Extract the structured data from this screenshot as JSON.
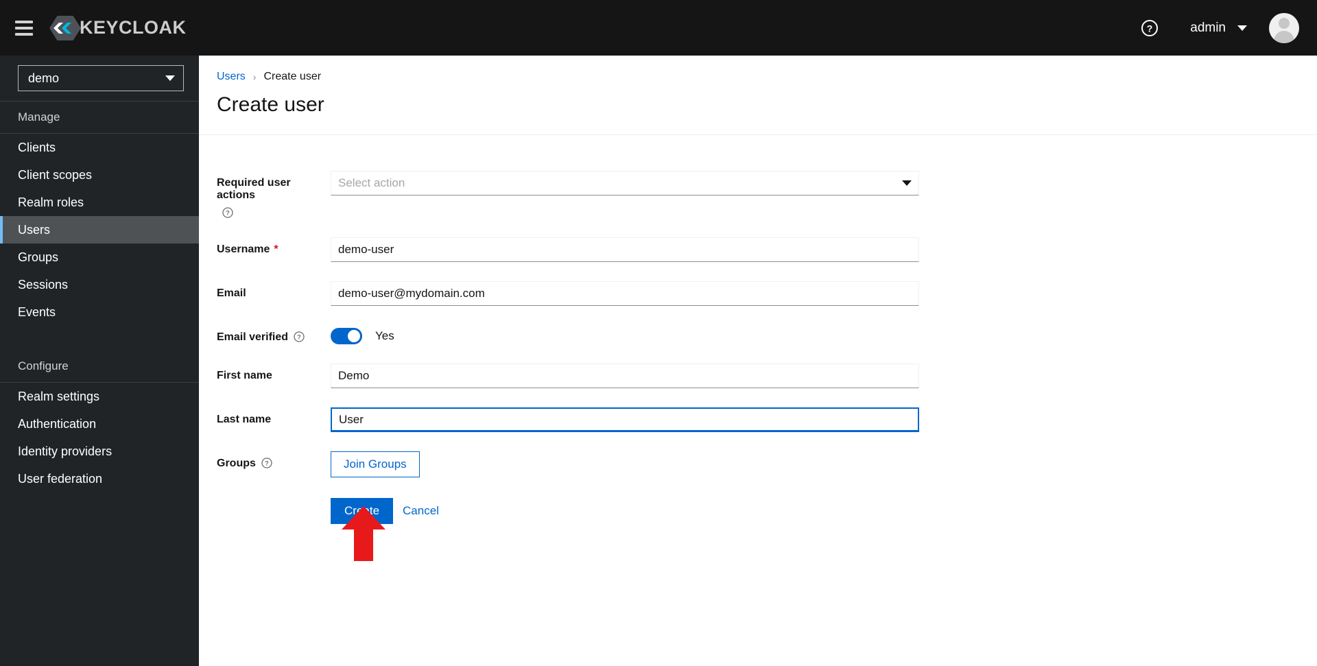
{
  "masthead": {
    "menu_icon": "hamburger-icon",
    "brand_name": "KEYCLOAK",
    "help_icon": "help-circle-icon",
    "user_name": "admin",
    "user_caret_icon": "chevron-down-icon",
    "avatar_icon": "user-avatar-icon",
    "background_color": "#151515"
  },
  "sidebar": {
    "realm_selector": {
      "value": "demo",
      "caret_icon": "chevron-down-icon"
    },
    "groups": [
      {
        "title": "Manage",
        "items": [
          {
            "label": "Clients",
            "active": false
          },
          {
            "label": "Client scopes",
            "active": false
          },
          {
            "label": "Realm roles",
            "active": false
          },
          {
            "label": "Users",
            "active": true
          },
          {
            "label": "Groups",
            "active": false
          },
          {
            "label": "Sessions",
            "active": false
          },
          {
            "label": "Events",
            "active": false
          }
        ]
      },
      {
        "title": "Configure",
        "items": [
          {
            "label": "Realm settings",
            "active": false
          },
          {
            "label": "Authentication",
            "active": false
          },
          {
            "label": "Identity providers",
            "active": false
          },
          {
            "label": "User federation",
            "active": false
          }
        ]
      }
    ],
    "background_color": "#212427",
    "active_indicator_color": "#73bcf7"
  },
  "page": {
    "breadcrumb": {
      "parent": "Users",
      "separator": "›",
      "current": "Create user"
    },
    "title": "Create user"
  },
  "form": {
    "required_user_actions": {
      "label": "Required user actions",
      "help_icon": "help-circle-icon",
      "placeholder": "Select action",
      "value": "",
      "caret_icon": "chevron-down-icon"
    },
    "username": {
      "label": "Username",
      "required_marker": "*",
      "value": "demo-user"
    },
    "email": {
      "label": "Email",
      "value": "demo-user@mydomain.com"
    },
    "email_verified": {
      "label": "Email verified",
      "help_icon": "help-circle-icon",
      "toggle_state": "on",
      "state_label": "Yes"
    },
    "first_name": {
      "label": "First name",
      "value": "Demo"
    },
    "last_name": {
      "label": "Last name",
      "value": "User",
      "focused": true
    },
    "groups": {
      "label": "Groups",
      "help_icon": "help-circle-icon",
      "button_label": "Join Groups"
    },
    "actions": {
      "submit_label": "Create",
      "cancel_label": "Cancel"
    },
    "accent_color": "#0066cc",
    "required_color": "#c9190b"
  },
  "annotation": {
    "arrow_icon": "up-arrow-annotation",
    "color": "#e8191b",
    "points_to": "Create"
  }
}
